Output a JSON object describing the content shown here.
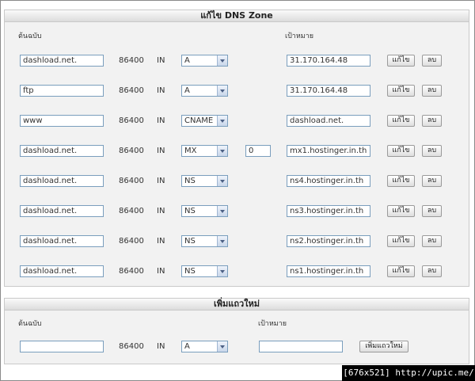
{
  "edit_zone": {
    "title": "แก้ไข DNS Zone",
    "source_label": "ต้นฉบับ",
    "target_label": "เป้าหมาย",
    "edit_label": "แก้ไข",
    "delete_label": "ลบ",
    "records": [
      {
        "name": "dashload.net.",
        "ttl": "86400",
        "class": "IN",
        "type": "A",
        "priority": "",
        "target": "31.170.164.48"
      },
      {
        "name": "ftp",
        "ttl": "86400",
        "class": "IN",
        "type": "A",
        "priority": "",
        "target": "31.170.164.48"
      },
      {
        "name": "www",
        "ttl": "86400",
        "class": "IN",
        "type": "CNAME",
        "priority": "",
        "target": "dashload.net."
      },
      {
        "name": "dashload.net.",
        "ttl": "86400",
        "class": "IN",
        "type": "MX",
        "priority": "0",
        "target": "mx1.hostinger.in.th"
      },
      {
        "name": "dashload.net.",
        "ttl": "86400",
        "class": "IN",
        "type": "NS",
        "priority": "",
        "target": "ns4.hostinger.in.th"
      },
      {
        "name": "dashload.net.",
        "ttl": "86400",
        "class": "IN",
        "type": "NS",
        "priority": "",
        "target": "ns3.hostinger.in.th"
      },
      {
        "name": "dashload.net.",
        "ttl": "86400",
        "class": "IN",
        "type": "NS",
        "priority": "",
        "target": "ns2.hostinger.in.th"
      },
      {
        "name": "dashload.net.",
        "ttl": "86400",
        "class": "IN",
        "type": "NS",
        "priority": "",
        "target": "ns1.hostinger.in.th"
      }
    ]
  },
  "add_row": {
    "title": "เพิ่มแถวใหม่",
    "source_label": "ต้นฉบับ",
    "target_label": "เป้าหมาย",
    "name": "",
    "ttl": "86400",
    "class": "IN",
    "type": "A",
    "target": "",
    "add_button_label": "เพิ่มแถวใหม่"
  },
  "footer": {
    "text": "[676x521] http://upic.me/"
  },
  "colors": {
    "input_border": "#7a9ebd",
    "panel_bg": "#f2f2f2",
    "footer_bg": "#000000"
  }
}
